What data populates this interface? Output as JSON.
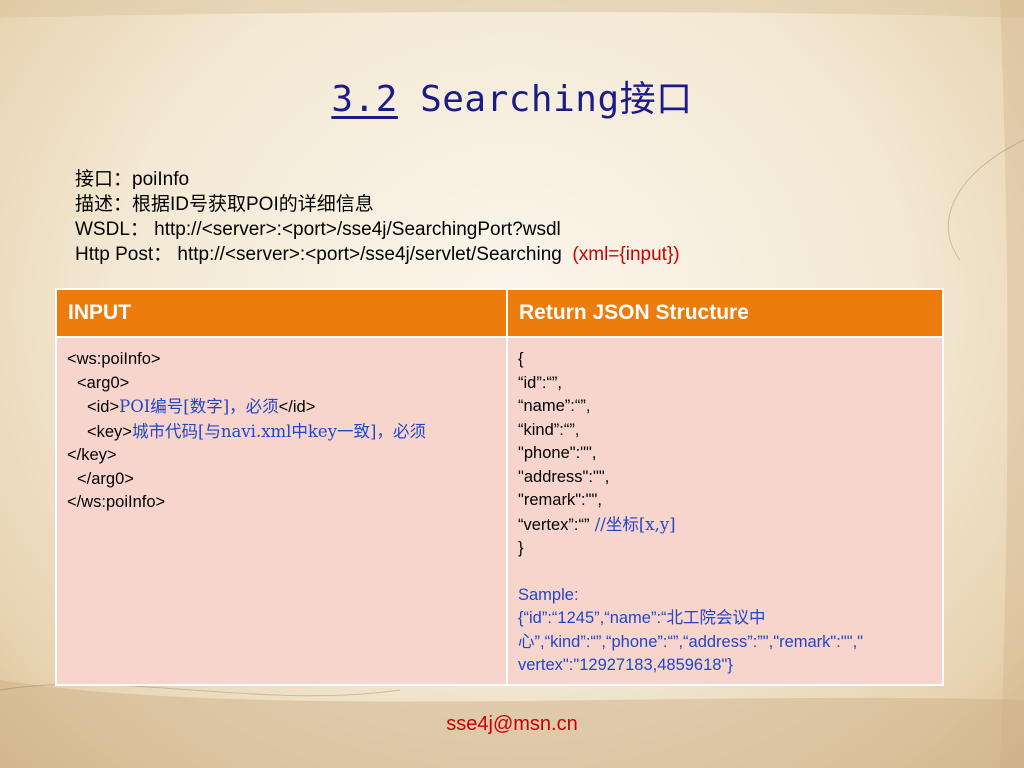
{
  "slide": {
    "title_num": "3.2",
    "title_text": " Searching接口"
  },
  "info": {
    "line1": "接口：poiInfo",
    "line2": "描述：根据ID号获取POI的详细信息",
    "line3": "WSDL： http://<server>:<port>/sse4j/SearchingPort?wsdl",
    "line4": "Http Post： http://<server>:<port>/sse4j/servlet/Searching",
    "line4_note": "(xml={input})"
  },
  "table": {
    "headers": [
      "INPUT",
      "Return JSON Structure"
    ],
    "input": {
      "l1": "<ws:poiInfo>",
      "l2": "<arg0>",
      "l3_open": "<id>",
      "l3_desc": "POI编号[数字]，必须",
      "l3_close": "</id>",
      "l4_open": "<key>",
      "l4_desc": "城市代码[与navi.xml中key一致]，必须",
      "l4_close": "</key>",
      "l5": "</arg0>",
      "l6": "</ws:poiInfo>"
    },
    "output": {
      "l1": "{",
      "l2": "“id”:“”,",
      "l3": "“name”:“”,",
      "l4": "“kind”:“”,",
      "l5": "\"phone\":\"\",",
      "l6": "\"address\":\"\",",
      "l7": "\"remark\":\"\",",
      "l8": "“vertex”:“”",
      "l8_comment": " //坐标[x,y]",
      "l9": "}",
      "sample_label": "Sample:",
      "sample_1": "{“id”:“1245”,“name”:“北工院会议中",
      "sample_2": "心”,“kind”:“”,“phone”:“”,“address”:”\",\"remark\":\"\",\"",
      "sample_3": "vertex\":\"12927183,4859618\"}"
    }
  },
  "footer": "sse4j@msn.cn",
  "colors": {
    "title": "#1b1b8a",
    "header_bg": "#ec7c0c",
    "cell_bg": "#f8d5cc",
    "accent_blue": "#1f47c7",
    "accent_red": "#cc0000"
  }
}
